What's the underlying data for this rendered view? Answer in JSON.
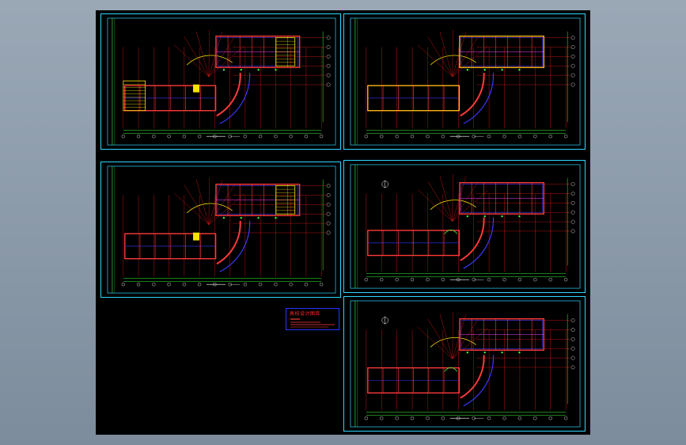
{
  "window": {
    "background_top": "#9aa8b6",
    "background_bottom": "#7d8c9c",
    "canvas_color": "#000000"
  },
  "colors": {
    "frame": "#2fd6ff",
    "axis": "#ff2020",
    "wall": "#ff3a3a",
    "wall_blue": "#3a3aff",
    "hatch_yellow": "#f5e400",
    "green": "#3bff3b",
    "white": "#ffffff",
    "magenta": "#ff40ff"
  },
  "sheets": [
    {
      "id": "sheet-1",
      "kind": "ground-plan-a"
    },
    {
      "id": "sheet-2",
      "kind": "roof-plan"
    },
    {
      "id": "sheet-3",
      "kind": "ground-plan-b"
    },
    {
      "id": "sheet-4",
      "kind": "upper-plan-a",
      "north_arrow": true
    },
    {
      "id": "sheet-5",
      "kind": "upper-plan-b",
      "north_arrow": true
    }
  ],
  "legend": {
    "title": "高校设计图库"
  }
}
